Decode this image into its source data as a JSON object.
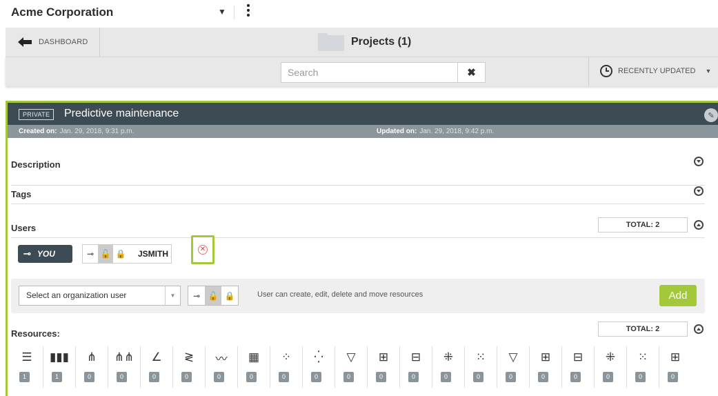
{
  "topbar": {
    "org_name": "Acme Corporation"
  },
  "nav": {
    "back_label": "DASHBOARD",
    "page_title": "Projects (1)"
  },
  "filter": {
    "search_placeholder": "Search",
    "clear_glyph": "✖",
    "sort_label": "RECENTLY UPDATED"
  },
  "project": {
    "badge": "PRIVATE",
    "title": "Predictive maintenance",
    "created_label": "Created on:",
    "created_value": "Jan. 29, 2018, 9:31 p.m.",
    "updated_label": "Updated on:",
    "updated_value": "Jan. 29, 2018, 9:42 p.m."
  },
  "sections": {
    "description": "Description",
    "tags": "Tags",
    "users": "Users",
    "users_total": "TOTAL: 2",
    "resources": "Resources:",
    "resources_total": "TOTAL: 2"
  },
  "users": {
    "you_label": "YOU",
    "member_name": "JSMITH",
    "remove_glyph": "✕"
  },
  "add_user": {
    "select_label": "Select an organization user",
    "permission_desc": "User can create, edit, delete and move resources",
    "add_label": "Add"
  },
  "resources": [
    {
      "icon": "database-icon",
      "glyph": "☰",
      "count": "1"
    },
    {
      "icon": "dataset-icon",
      "glyph": "▮▮▮",
      "count": "1"
    },
    {
      "icon": "model-icon",
      "glyph": "⋔",
      "count": "0"
    },
    {
      "icon": "ensemble-icon",
      "glyph": "⋔⋔",
      "count": "0"
    },
    {
      "icon": "logistic-regression-icon",
      "glyph": "∠",
      "count": "0"
    },
    {
      "icon": "deepnet-icon",
      "glyph": "≷",
      "count": "0"
    },
    {
      "icon": "time-series-icon",
      "glyph": "〰",
      "count": "0"
    },
    {
      "icon": "cluster-grid-icon",
      "glyph": "▦",
      "count": "0"
    },
    {
      "icon": "cluster-icon",
      "glyph": "⁘",
      "count": "0"
    },
    {
      "icon": "anomaly-icon",
      "glyph": "⁛",
      "count": "0"
    },
    {
      "icon": "association-icon",
      "glyph": "▽",
      "count": "0"
    },
    {
      "icon": "topic-model-icon",
      "glyph": "⊞",
      "count": "0"
    },
    {
      "icon": "pca-icon",
      "glyph": "⊟",
      "count": "0"
    },
    {
      "icon": "prediction-icon",
      "glyph": "⁜",
      "count": "0"
    },
    {
      "icon": "batch-prediction-icon",
      "glyph": "⁙",
      "count": "0"
    },
    {
      "icon": "centroid-icon",
      "glyph": "▽",
      "count": "0"
    },
    {
      "icon": "batch-centroid-icon",
      "glyph": "⊞",
      "count": "0"
    },
    {
      "icon": "evaluation-icon",
      "glyph": "⊟",
      "count": "0"
    },
    {
      "icon": "anomaly-score-icon",
      "glyph": "⁜",
      "count": "0"
    },
    {
      "icon": "batch-anomaly-score-icon",
      "glyph": "⁙",
      "count": "0"
    },
    {
      "icon": "projection-icon",
      "glyph": "⊞",
      "count": "0"
    }
  ]
}
